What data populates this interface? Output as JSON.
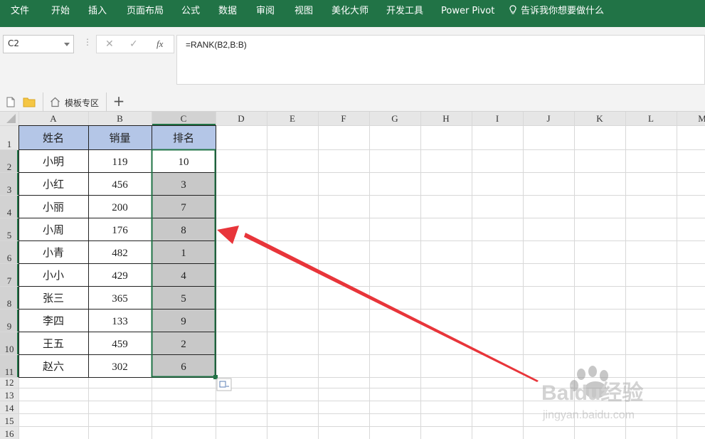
{
  "menu": {
    "items": [
      "文件",
      "开始",
      "插入",
      "页面布局",
      "公式",
      "数据",
      "审阅",
      "视图",
      "美化大师",
      "开发工具",
      "Power Pivot"
    ],
    "tell_me": "告诉我你想要做什么"
  },
  "formula_bar": {
    "name_box": "C2",
    "formula": "=RANK(B2,B:B)",
    "fx_label": "fx"
  },
  "tabs": {
    "template_tab": "模板专区"
  },
  "sheet": {
    "columns": [
      "A",
      "B",
      "C",
      "D",
      "E",
      "F",
      "G",
      "H",
      "I",
      "J",
      "K",
      "L",
      "M"
    ],
    "rows": [
      "1",
      "2",
      "3",
      "4",
      "5",
      "6",
      "7",
      "8",
      "9",
      "10",
      "11",
      "12",
      "13",
      "14",
      "15",
      "16"
    ],
    "selected_cell": "C2",
    "header_row": [
      "姓名",
      "销量",
      "排名"
    ],
    "data": [
      [
        "小明",
        "119",
        "10"
      ],
      [
        "小红",
        "456",
        "3"
      ],
      [
        "小丽",
        "200",
        "7"
      ],
      [
        "小周",
        "176",
        "8"
      ],
      [
        "小青",
        "482",
        "1"
      ],
      [
        "小小",
        "429",
        "4"
      ],
      [
        "张三",
        "365",
        "5"
      ],
      [
        "李四",
        "133",
        "9"
      ],
      [
        "王五",
        "459",
        "2"
      ],
      [
        "赵六",
        "302",
        "6"
      ]
    ]
  },
  "colors": {
    "ribbon": "#217346",
    "header_fill": "#b4c6e7",
    "selection_fill": "#c8c8c8",
    "selection_border": "#217346",
    "arrow": "#e8353a"
  },
  "watermark": {
    "brand": "Baidu经验",
    "url": "jingyan.baidu.com"
  }
}
